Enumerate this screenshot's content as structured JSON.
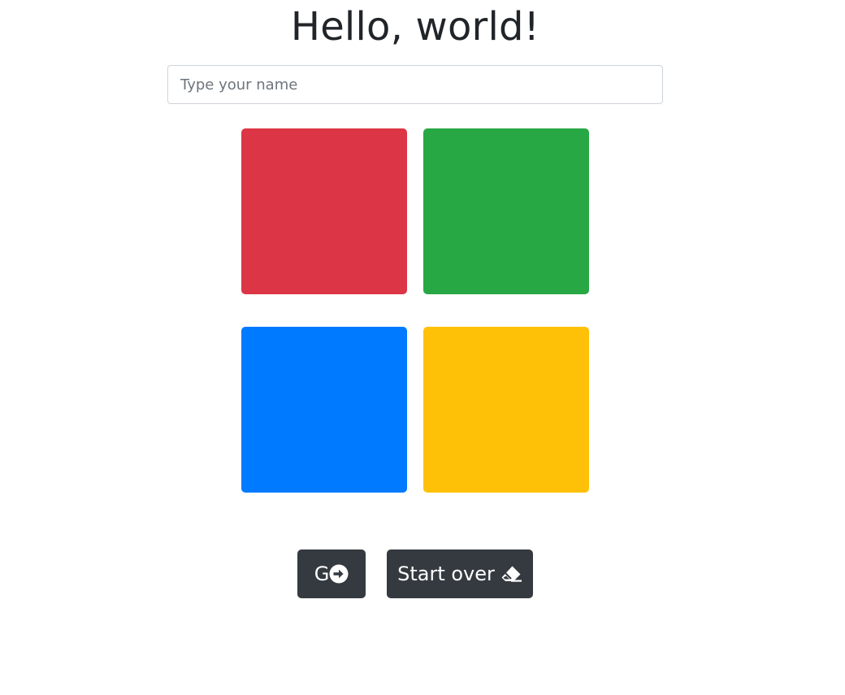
{
  "header": {
    "title": "Hello, world!"
  },
  "name_input": {
    "placeholder": "Type your name",
    "value": ""
  },
  "tiles": [
    {
      "color_name": "red",
      "color": "#dc3545"
    },
    {
      "color_name": "green",
      "color": "#28a745"
    },
    {
      "color_name": "blue",
      "color": "#007bff"
    },
    {
      "color_name": "yellow",
      "color": "#ffc107"
    }
  ],
  "buttons": {
    "go": {
      "label": "G",
      "icon": "arrow-circle-right-icon"
    },
    "reset": {
      "label": "Start over",
      "icon": "eraser-icon"
    }
  },
  "theme": {
    "button_bg": "#343a40",
    "text": "#212529"
  }
}
